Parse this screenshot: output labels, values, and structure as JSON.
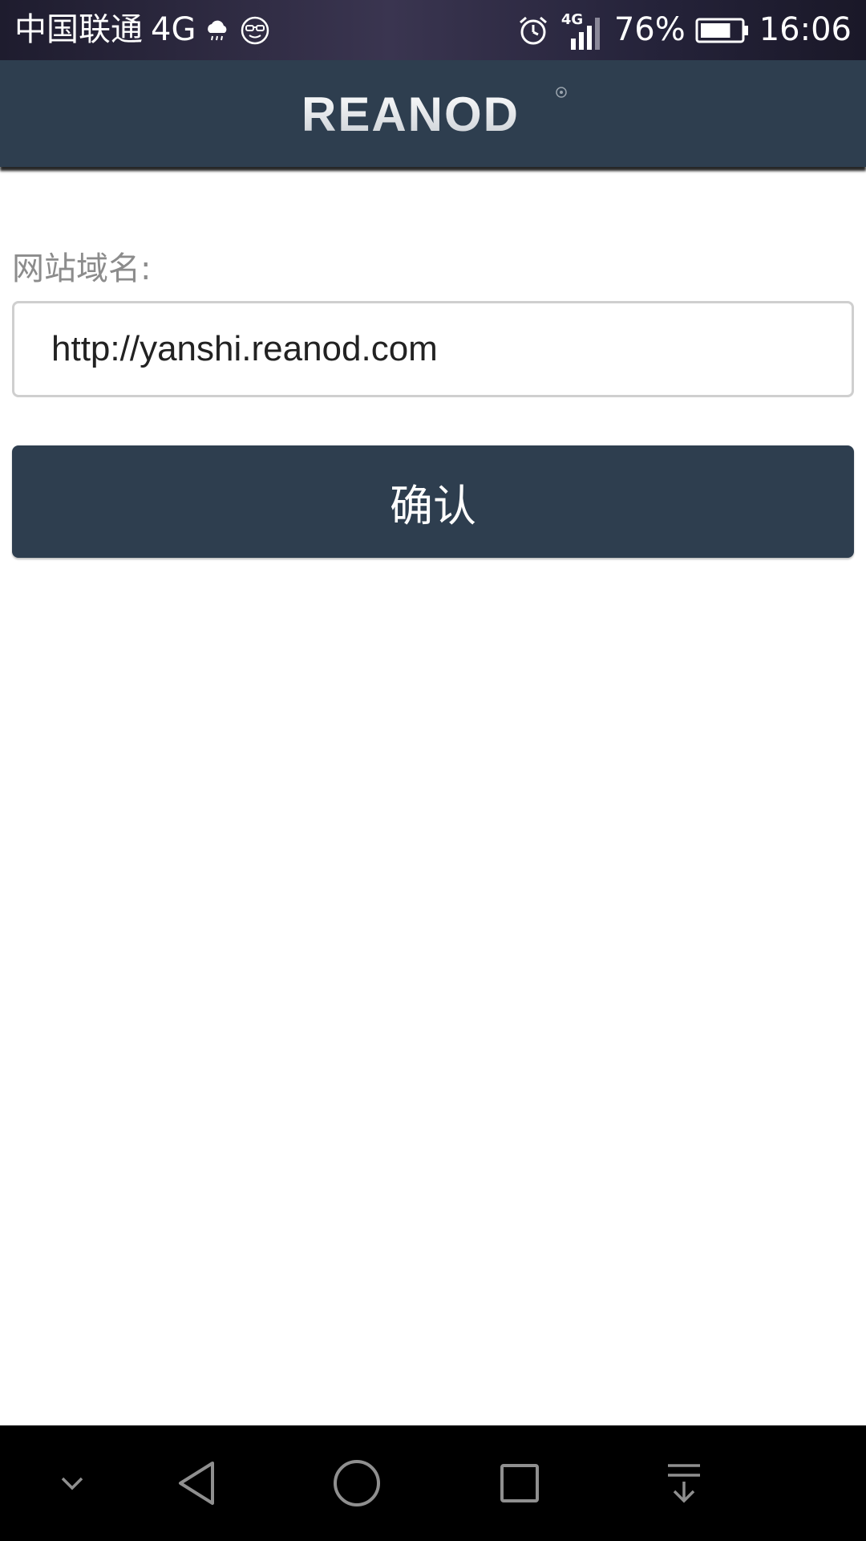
{
  "status_bar": {
    "carrier": "中国联通",
    "network": "4G",
    "signal_network": "4G",
    "battery_percent": "76%",
    "battery_level": 0.76,
    "time": "16:06",
    "icons": [
      "weather-rain-icon",
      "sunglasses-face-icon",
      "alarm-clock-icon",
      "signal-icon",
      "battery-icon"
    ]
  },
  "header": {
    "logo_text": "REANOD",
    "bg_color": "#2e3e4f"
  },
  "form": {
    "domain_label": "网站域名:",
    "domain_value": "http://yanshi.reanod.com",
    "confirm_label": "确认"
  },
  "nav_bar": {
    "buttons": [
      "chevron-down-icon",
      "back-triangle-icon",
      "home-circle-icon",
      "recents-square-icon",
      "notification-pull-down-icon"
    ]
  },
  "colors": {
    "accent": "#2e3e4f",
    "label_gray": "#8c8c8c",
    "input_border": "#cfcfcf"
  }
}
